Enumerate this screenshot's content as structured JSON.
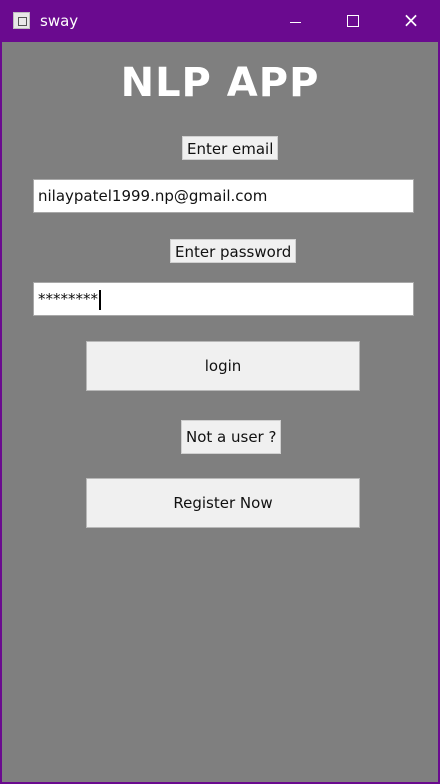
{
  "window": {
    "title": "sway",
    "controls": {
      "minimize": "minimize-icon",
      "maximize": "maximize-icon",
      "close": "close-icon"
    },
    "colors": {
      "titlebar": "#6a0a8f",
      "content_background": "#7f7f7f"
    }
  },
  "app": {
    "title": "NLP APP",
    "email_label": "Enter email",
    "email_value": "nilaypatel1999.np@gmail.com",
    "password_label": "Enter password",
    "password_value": "********",
    "login_label": "login",
    "not_user_label": "Not a user ?",
    "register_label": "Register Now"
  }
}
